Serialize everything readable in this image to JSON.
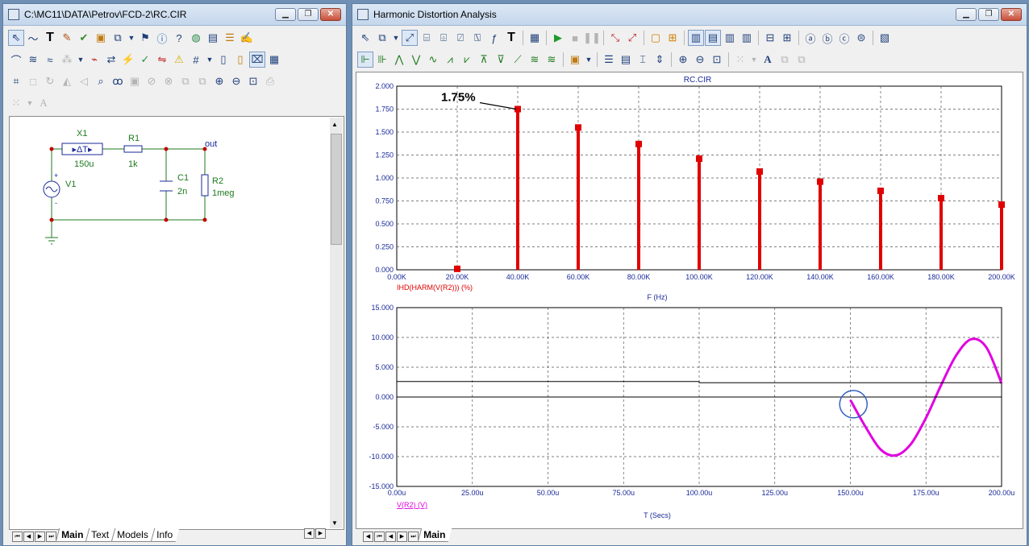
{
  "left_window": {
    "title": "C:\\MC11\\DATA\\Petrov\\FCD-2\\RC.CIR",
    "window_buttons": [
      "minimize",
      "restore",
      "close"
    ],
    "toolbar_row1": [
      "select-arrow-icon",
      "wire-icon",
      "text-tool-icon",
      "pen-icon",
      "check-icon",
      "component-icon",
      "copy-icon",
      "dropdown-icon",
      "flag-icon",
      "info-icon",
      "help-icon",
      "globe-icon",
      "edit-icon",
      "list-icon",
      "notes-icon"
    ],
    "toolbar_row2": [
      "node-numbers-icon",
      "node-voltages-icon",
      "node-currents-icon",
      "pins-icon",
      "dropdown-icon",
      "probe-icon",
      "arrows-icon",
      "flash-icon",
      "check-arrow-icon",
      "swap-icon",
      "warning-icon",
      "grid-icon",
      "dropdown-icon",
      "page-icon",
      "page2-icon",
      "title-block-icon",
      "properties-icon"
    ],
    "toolbar_row3": [
      "align-icon",
      "box-icon",
      "rotate-icon",
      "mirror-icon",
      "flip-icon",
      "find-icon",
      "binoculars-icon",
      "paste-icon",
      "stop-icon",
      "cancel-icon",
      "front-icon",
      "back-icon",
      "zoom-in-icon",
      "zoom-out-icon",
      "zoom-fit-icon",
      "print-icon"
    ],
    "toolbar_row4": [
      "grid-dots-icon",
      "dropdown-icon",
      "font-icon"
    ],
    "schematic": {
      "x1_name": "X1",
      "x1_symbol": "▸ΔT▸",
      "x1_value": "150u",
      "r1_name": "R1",
      "r1_value": "1k",
      "c1_name": "C1",
      "c1_value": "2n",
      "r2_name": "R2",
      "r2_value": "1meg",
      "v1_name": "V1",
      "plus": "+",
      "minus": "-",
      "node_out": "out"
    },
    "tabs": [
      "Main",
      "Text",
      "Models",
      "Info"
    ],
    "active_tab": "Main"
  },
  "right_window": {
    "title": "Harmonic Distortion Analysis",
    "window_buttons": [
      "minimize",
      "restore",
      "close"
    ],
    "toolbar_row1": [
      "select-arrow-icon",
      "copy-icon",
      "dropdown-icon",
      "scale-icon",
      "data-points-icon",
      "tokens-icon",
      "ruler-icon",
      "grid-icon",
      "expression-icon",
      "text-tool-icon",
      "properties-icon",
      "run-icon",
      "stop-icon",
      "pause-icon",
      "cursor-left-icon",
      "cursor-right-icon",
      "window-icon",
      "tile-icon",
      "format1-icon",
      "format2-icon",
      "format3-icon",
      "format4-icon",
      "horizontal-split-icon",
      "grid-box-icon",
      "zoom-a-icon",
      "zoom-b-icon",
      "zoom-c-icon",
      "zoom-d-icon",
      "info-icon"
    ],
    "toolbar_row2": [
      "peak-icon",
      "valley-icon",
      "high-icon",
      "low-icon",
      "inflection-icon",
      "global-high-icon",
      "global-low-icon",
      "top-icon",
      "bottom-icon",
      "slope-icon",
      "next-icon",
      "prev-icon",
      "paste-icon",
      "dropdown-icon",
      "list-icon",
      "copy-to-clipboard-icon",
      "bracket-icon",
      "range-icon",
      "zoom-in-icon",
      "zoom-out-icon",
      "zoom-region-icon",
      "grid-dots-icon",
      "dropdown-icon",
      "font-icon",
      "front-icon",
      "back-icon"
    ],
    "tabs": [
      "Main"
    ],
    "active_tab": "Main"
  },
  "chart_data": [
    {
      "type": "bar",
      "title": "RC.CIR",
      "xlabel": "F (Hz)",
      "ylabel": "",
      "series": [
        {
          "name": "IHD(HARM(V(R2))) (%)",
          "color": "#e00000"
        }
      ],
      "x": [
        20000,
        40000,
        60000,
        80000,
        100000,
        120000,
        140000,
        160000,
        180000,
        200000
      ],
      "values": [
        0.01,
        1.75,
        1.55,
        1.37,
        1.21,
        1.07,
        0.96,
        0.86,
        0.78,
        0.71
      ],
      "xlim": [
        0,
        200000
      ],
      "ylim": [
        0,
        2.0
      ],
      "x_ticks": [
        "0.00K",
        "20.00K",
        "40.00K",
        "60.00K",
        "80.00K",
        "100.00K",
        "120.00K",
        "140.00K",
        "160.00K",
        "180.00K",
        "200.00K"
      ],
      "y_ticks": [
        "0.000",
        "0.250",
        "0.500",
        "0.750",
        "1.000",
        "1.250",
        "1.500",
        "1.750",
        "2.000"
      ],
      "annotation": {
        "text": "1.75%",
        "x": 40000,
        "y": 1.75
      },
      "grid": true
    },
    {
      "type": "line",
      "title": "",
      "xlabel": "T (Secs)",
      "ylabel": "",
      "series": [
        {
          "name": "V(R2) (V)",
          "color": "#e000e0",
          "t": [
            0.00015,
            0.000155,
            0.00016,
            0.000165,
            0.00017,
            0.000175,
            0.00018,
            0.000185,
            0.00019,
            0.000195,
            0.0002
          ],
          "values": [
            -0.5,
            -5.0,
            -8.8,
            -9.8,
            -7.9,
            -3.5,
            2.0,
            7.0,
            9.7,
            8.3,
            2.3
          ]
        },
        {
          "name": "",
          "color": "#000000",
          "t": [
            0,
            0.0001,
            0.0001,
            0.0002
          ],
          "values": [
            2.6,
            2.6,
            2.4,
            2.4
          ]
        },
        {
          "name": "",
          "color": "#000000",
          "t": [
            0,
            0.0002
          ],
          "values": [
            0,
            0
          ]
        }
      ],
      "xlim": [
        0,
        0.0002
      ],
      "ylim": [
        -15,
        15
      ],
      "x_ticks": [
        "0.00u",
        "25.00u",
        "50.00u",
        "75.00u",
        "100.00u",
        "125.00u",
        "150.00u",
        "175.00u",
        "200.00u"
      ],
      "y_ticks": [
        "-15.000",
        "-10.000",
        "-5.000",
        "0.000",
        "5.000",
        "10.000",
        "15.000"
      ],
      "marker": {
        "shape": "circle",
        "color": "#3060c0",
        "t": 0.000151,
        "y": -1.2
      },
      "grid": true
    }
  ]
}
